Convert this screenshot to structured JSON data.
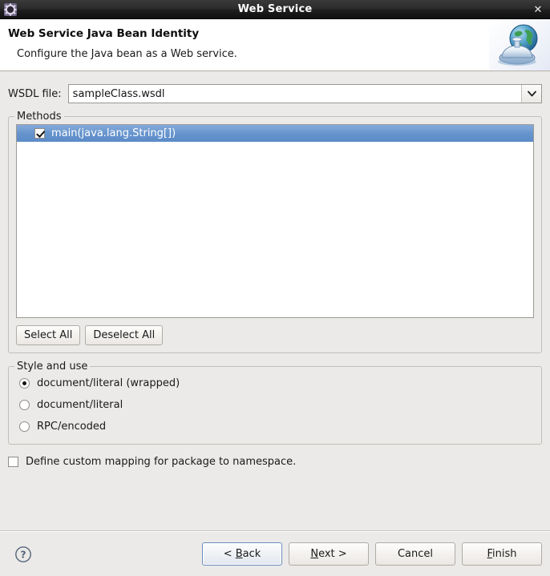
{
  "window": {
    "title": "Web Service",
    "icon": "gear-icon",
    "close_label": "✕"
  },
  "header": {
    "title": "Web Service Java Bean Identity",
    "description": "Configure the Java bean as a Web service.",
    "icon": "web-service-globe-icon"
  },
  "wsdl": {
    "label": "WSDL file:",
    "value": "sampleClass.wsdl",
    "placeholder": "",
    "arrow": "∨"
  },
  "methods": {
    "group_title": "Methods",
    "items": [
      {
        "label": "main(java.lang.String[])",
        "checked": true,
        "selected": true
      }
    ],
    "select_all_label": "Select All",
    "deselect_all_label": "Deselect All"
  },
  "style_and_use": {
    "group_title": "Style and use",
    "options": [
      {
        "label": "document/literal (wrapped)",
        "selected": true
      },
      {
        "label": "document/literal",
        "selected": false
      },
      {
        "label": "RPC/encoded",
        "selected": false
      }
    ]
  },
  "custom_mapping": {
    "label": "Define custom mapping for package to namespace.",
    "checked": false
  },
  "footer": {
    "help_icon": "help-question-icon",
    "buttons": {
      "back": {
        "prefix": "< ",
        "mnemonic": "B",
        "suffix": "ack",
        "focused": true
      },
      "next": {
        "prefix": "",
        "mnemonic": "N",
        "suffix": "ext >",
        "focused": false
      },
      "cancel": {
        "label": "Cancel",
        "focused": false
      },
      "finish": {
        "prefix": "",
        "mnemonic": "F",
        "suffix": "inish",
        "focused": false
      }
    }
  },
  "colors": {
    "selection_blue": "#6694cd",
    "background": "#ebeae8",
    "titlebar": "#1e1e1e",
    "accent_focus": "#6a8dbd"
  }
}
